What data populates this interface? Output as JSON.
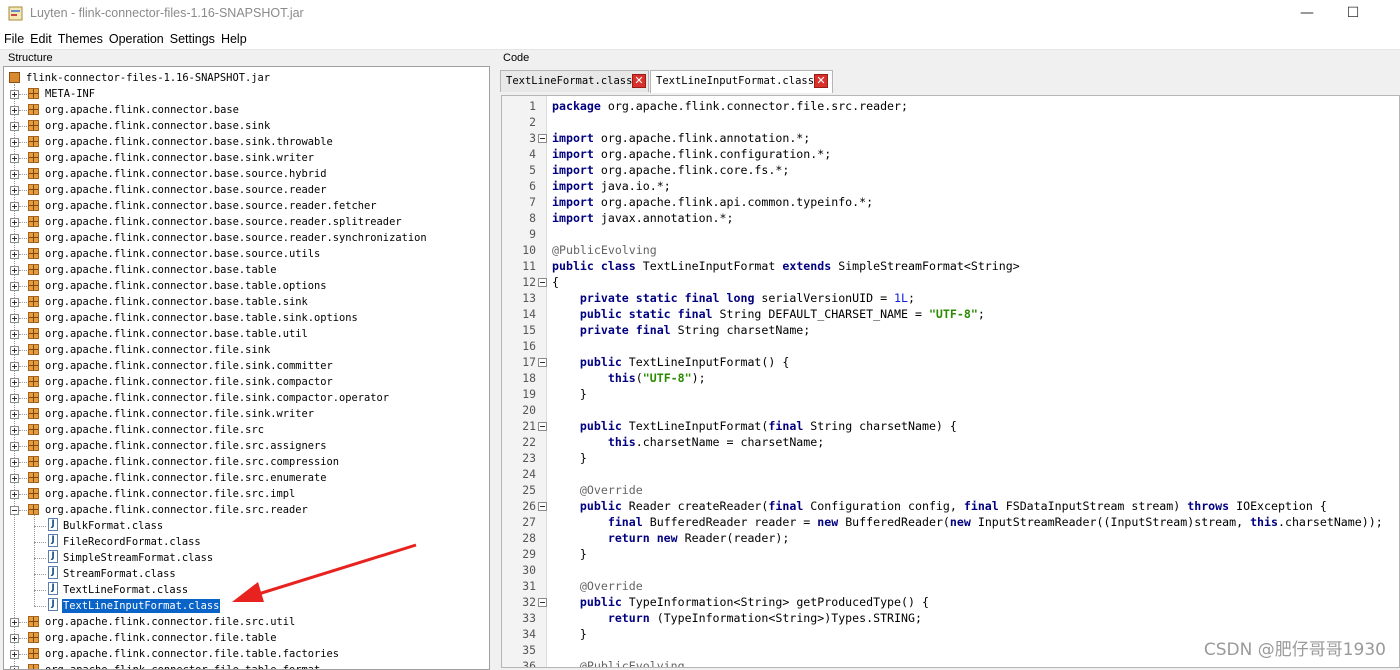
{
  "window": {
    "title": "Luyten - flink-connector-files-1.16-SNAPSHOT.jar",
    "minimize_glyph": "—",
    "maximize_glyph": "☐"
  },
  "menu": [
    "File",
    "Edit",
    "Themes",
    "Operation",
    "Settings",
    "Help"
  ],
  "structure": {
    "label": "Structure",
    "root": "flink-connector-files-1.16-SNAPSHOT.jar",
    "rows": [
      {
        "name": "META-INF",
        "type": "package",
        "depth": 1,
        "expanded": false
      },
      {
        "name": "org.apache.flink.connector.base",
        "type": "package",
        "depth": 1,
        "expanded": false
      },
      {
        "name": "org.apache.flink.connector.base.sink",
        "type": "package",
        "depth": 1,
        "expanded": false
      },
      {
        "name": "org.apache.flink.connector.base.sink.throwable",
        "type": "package",
        "depth": 1,
        "expanded": false
      },
      {
        "name": "org.apache.flink.connector.base.sink.writer",
        "type": "package",
        "depth": 1,
        "expanded": false
      },
      {
        "name": "org.apache.flink.connector.base.source.hybrid",
        "type": "package",
        "depth": 1,
        "expanded": false
      },
      {
        "name": "org.apache.flink.connector.base.source.reader",
        "type": "package",
        "depth": 1,
        "expanded": false
      },
      {
        "name": "org.apache.flink.connector.base.source.reader.fetcher",
        "type": "package",
        "depth": 1,
        "expanded": false
      },
      {
        "name": "org.apache.flink.connector.base.source.reader.splitreader",
        "type": "package",
        "depth": 1,
        "expanded": false
      },
      {
        "name": "org.apache.flink.connector.base.source.reader.synchronization",
        "type": "package",
        "depth": 1,
        "expanded": false
      },
      {
        "name": "org.apache.flink.connector.base.source.utils",
        "type": "package",
        "depth": 1,
        "expanded": false
      },
      {
        "name": "org.apache.flink.connector.base.table",
        "type": "package",
        "depth": 1,
        "expanded": false
      },
      {
        "name": "org.apache.flink.connector.base.table.options",
        "type": "package",
        "depth": 1,
        "expanded": false
      },
      {
        "name": "org.apache.flink.connector.base.table.sink",
        "type": "package",
        "depth": 1,
        "expanded": false
      },
      {
        "name": "org.apache.flink.connector.base.table.sink.options",
        "type": "package",
        "depth": 1,
        "expanded": false
      },
      {
        "name": "org.apache.flink.connector.base.table.util",
        "type": "package",
        "depth": 1,
        "expanded": false
      },
      {
        "name": "org.apache.flink.connector.file.sink",
        "type": "package",
        "depth": 1,
        "expanded": false
      },
      {
        "name": "org.apache.flink.connector.file.sink.committer",
        "type": "package",
        "depth": 1,
        "expanded": false
      },
      {
        "name": "org.apache.flink.connector.file.sink.compactor",
        "type": "package",
        "depth": 1,
        "expanded": false
      },
      {
        "name": "org.apache.flink.connector.file.sink.compactor.operator",
        "type": "package",
        "depth": 1,
        "expanded": false
      },
      {
        "name": "org.apache.flink.connector.file.sink.writer",
        "type": "package",
        "depth": 1,
        "expanded": false
      },
      {
        "name": "org.apache.flink.connector.file.src",
        "type": "package",
        "depth": 1,
        "expanded": false
      },
      {
        "name": "org.apache.flink.connector.file.src.assigners",
        "type": "package",
        "depth": 1,
        "expanded": false
      },
      {
        "name": "org.apache.flink.connector.file.src.compression",
        "type": "package",
        "depth": 1,
        "expanded": false
      },
      {
        "name": "org.apache.flink.connector.file.src.enumerate",
        "type": "package",
        "depth": 1,
        "expanded": false
      },
      {
        "name": "org.apache.flink.connector.file.src.impl",
        "type": "package",
        "depth": 1,
        "expanded": false
      },
      {
        "name": "org.apache.flink.connector.file.src.reader",
        "type": "package",
        "depth": 1,
        "expanded": true
      },
      {
        "name": "BulkFormat.class",
        "type": "class",
        "depth": 2
      },
      {
        "name": "FileRecordFormat.class",
        "type": "class",
        "depth": 2
      },
      {
        "name": "SimpleStreamFormat.class",
        "type": "class",
        "depth": 2
      },
      {
        "name": "StreamFormat.class",
        "type": "class",
        "depth": 2
      },
      {
        "name": "TextLineFormat.class",
        "type": "class",
        "depth": 2
      },
      {
        "name": "TextLineInputFormat.class",
        "type": "class",
        "depth": 2,
        "selected": true
      },
      {
        "name": "org.apache.flink.connector.file.src.util",
        "type": "package",
        "depth": 1,
        "expanded": false
      },
      {
        "name": "org.apache.flink.connector.file.table",
        "type": "package",
        "depth": 1,
        "expanded": false
      },
      {
        "name": "org.apache.flink.connector.file.table.factories",
        "type": "package",
        "depth": 1,
        "expanded": false
      },
      {
        "name": "org.apache.flink.connector.file.table.format",
        "type": "package",
        "depth": 1,
        "expanded": false
      }
    ]
  },
  "code_panel": {
    "label": "Code",
    "tabs": [
      {
        "label": "TextLineFormat.class",
        "active": false
      },
      {
        "label": "TextLineInputFormat.class",
        "active": true
      }
    ],
    "lines": [
      {
        "n": "1",
        "fold": false,
        "tokens": [
          [
            "kw",
            "package"
          ],
          [
            "t",
            " org.apache.flink.connector.file.src.reader;"
          ]
        ]
      },
      {
        "n": "2",
        "fold": false,
        "tokens": []
      },
      {
        "n": "3",
        "fold": true,
        "tokens": [
          [
            "kw",
            "import"
          ],
          [
            "t",
            " org.apache.flink.annotation.*;"
          ]
        ]
      },
      {
        "n": "4",
        "fold": false,
        "tokens": [
          [
            "kw",
            "import"
          ],
          [
            "t",
            " org.apache.flink.configuration.*;"
          ]
        ]
      },
      {
        "n": "5",
        "fold": false,
        "tokens": [
          [
            "kw",
            "import"
          ],
          [
            "t",
            " org.apache.flink.core.fs.*;"
          ]
        ]
      },
      {
        "n": "6",
        "fold": false,
        "tokens": [
          [
            "kw",
            "import"
          ],
          [
            "t",
            " java.io.*;"
          ]
        ]
      },
      {
        "n": "7",
        "fold": false,
        "tokens": [
          [
            "kw",
            "import"
          ],
          [
            "t",
            " org.apache.flink.api.common.typeinfo.*;"
          ]
        ]
      },
      {
        "n": "8",
        "fold": false,
        "tokens": [
          [
            "kw",
            "import"
          ],
          [
            "t",
            " javax.annotation.*;"
          ]
        ]
      },
      {
        "n": "9",
        "fold": false,
        "tokens": []
      },
      {
        "n": "10",
        "fold": false,
        "tokens": [
          [
            "ann",
            "@PublicEvolving"
          ]
        ]
      },
      {
        "n": "11",
        "fold": false,
        "tokens": [
          [
            "kw",
            "public class"
          ],
          [
            "t",
            " TextLineInputFormat "
          ],
          [
            "kw",
            "extends"
          ],
          [
            "t",
            " SimpleStreamFormat<String>"
          ]
        ]
      },
      {
        "n": "12",
        "fold": true,
        "tokens": [
          [
            "t",
            "{"
          ]
        ]
      },
      {
        "n": "13",
        "fold": false,
        "tokens": [
          [
            "t",
            "    "
          ],
          [
            "kw",
            "private static final long"
          ],
          [
            "t",
            " serialVersionUID = "
          ],
          [
            "num",
            "1L"
          ],
          [
            "t",
            ";"
          ]
        ]
      },
      {
        "n": "14",
        "fold": false,
        "tokens": [
          [
            "t",
            "    "
          ],
          [
            "kw",
            "public static final"
          ],
          [
            "t",
            " String DEFAULT_CHARSET_NAME = "
          ],
          [
            "str",
            "\"UTF-8\""
          ],
          [
            "t",
            ";"
          ]
        ]
      },
      {
        "n": "15",
        "fold": false,
        "tokens": [
          [
            "t",
            "    "
          ],
          [
            "kw",
            "private final"
          ],
          [
            "t",
            " String charsetName;"
          ]
        ]
      },
      {
        "n": "16",
        "fold": false,
        "tokens": []
      },
      {
        "n": "17",
        "fold": true,
        "tokens": [
          [
            "t",
            "    "
          ],
          [
            "kw",
            "public"
          ],
          [
            "t",
            " TextLineInputFormat() {"
          ]
        ]
      },
      {
        "n": "18",
        "fold": false,
        "tokens": [
          [
            "t",
            "        "
          ],
          [
            "kw",
            "this"
          ],
          [
            "t",
            "("
          ],
          [
            "str",
            "\"UTF-8\""
          ],
          [
            "t",
            ");"
          ]
        ]
      },
      {
        "n": "19",
        "fold": false,
        "tokens": [
          [
            "t",
            "    }"
          ]
        ]
      },
      {
        "n": "20",
        "fold": false,
        "tokens": []
      },
      {
        "n": "21",
        "fold": true,
        "tokens": [
          [
            "t",
            "    "
          ],
          [
            "kw",
            "public"
          ],
          [
            "t",
            " TextLineInputFormat("
          ],
          [
            "kw",
            "final"
          ],
          [
            "t",
            " String charsetName) {"
          ]
        ]
      },
      {
        "n": "22",
        "fold": false,
        "tokens": [
          [
            "t",
            "        "
          ],
          [
            "kw",
            "this"
          ],
          [
            "t",
            ".charsetName = charsetName;"
          ]
        ]
      },
      {
        "n": "23",
        "fold": false,
        "tokens": [
          [
            "t",
            "    }"
          ]
        ]
      },
      {
        "n": "24",
        "fold": false,
        "tokens": []
      },
      {
        "n": "25",
        "fold": false,
        "tokens": [
          [
            "t",
            "    "
          ],
          [
            "ann",
            "@Override"
          ]
        ]
      },
      {
        "n": "26",
        "fold": true,
        "tokens": [
          [
            "t",
            "    "
          ],
          [
            "kw",
            "public"
          ],
          [
            "t",
            " Reader createReader("
          ],
          [
            "kw",
            "final"
          ],
          [
            "t",
            " Configuration config, "
          ],
          [
            "kw",
            "final"
          ],
          [
            "t",
            " FSDataInputStream stream) "
          ],
          [
            "kw",
            "throws"
          ],
          [
            "t",
            " IOException {"
          ]
        ]
      },
      {
        "n": "27",
        "fold": false,
        "tokens": [
          [
            "t",
            "        "
          ],
          [
            "kw",
            "final"
          ],
          [
            "t",
            " BufferedReader reader = "
          ],
          [
            "kw",
            "new"
          ],
          [
            "t",
            " BufferedReader("
          ],
          [
            "kw",
            "new"
          ],
          [
            "t",
            " InputStreamReader((InputStream)stream, "
          ],
          [
            "kw",
            "this"
          ],
          [
            "t",
            ".charsetName));"
          ]
        ]
      },
      {
        "n": "28",
        "fold": false,
        "tokens": [
          [
            "t",
            "        "
          ],
          [
            "kw",
            "return new"
          ],
          [
            "t",
            " Reader(reader);"
          ]
        ]
      },
      {
        "n": "29",
        "fold": false,
        "tokens": [
          [
            "t",
            "    }"
          ]
        ]
      },
      {
        "n": "30",
        "fold": false,
        "tokens": []
      },
      {
        "n": "31",
        "fold": false,
        "tokens": [
          [
            "t",
            "    "
          ],
          [
            "ann",
            "@Override"
          ]
        ]
      },
      {
        "n": "32",
        "fold": true,
        "tokens": [
          [
            "t",
            "    "
          ],
          [
            "kw",
            "public"
          ],
          [
            "t",
            " TypeInformation<String> getProducedType() {"
          ]
        ]
      },
      {
        "n": "33",
        "fold": false,
        "tokens": [
          [
            "t",
            "        "
          ],
          [
            "kw",
            "return"
          ],
          [
            "t",
            " (TypeInformation<String>)Types.STRING;"
          ]
        ]
      },
      {
        "n": "34",
        "fold": false,
        "tokens": [
          [
            "t",
            "    }"
          ]
        ]
      },
      {
        "n": "35",
        "fold": false,
        "tokens": []
      },
      {
        "n": "36",
        "fold": false,
        "tokens": [
          [
            "t",
            "    "
          ],
          [
            "ann",
            "@PublicEvolving"
          ]
        ]
      }
    ]
  },
  "watermark": "CSDN @肥仔哥哥1930",
  "colors": {
    "selection": "#0a64c8",
    "arrow": "#e8231f",
    "keyword": "#000080",
    "string": "#2a8a00"
  }
}
